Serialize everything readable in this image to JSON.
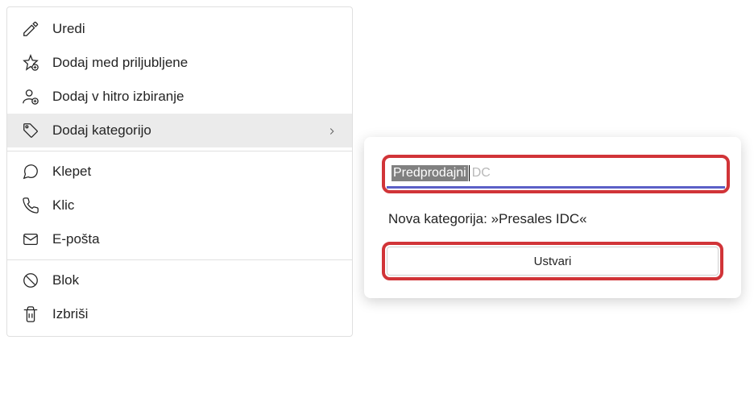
{
  "menu": {
    "edit": "Uredi",
    "addFavorite": "Dodaj med priljubljene",
    "addSpeedDial": "Dodaj v hitro izbiranje",
    "addCategory": "Dodaj kategorijo",
    "chat": "Klepet",
    "call": "Klic",
    "email": "E-pošta",
    "block": "Blok",
    "delete": "Izbriši"
  },
  "popup": {
    "inputHighlighted": "Predprodajni",
    "inputRest": "DC",
    "hint": "Nova kategorija: »Presales IDC«",
    "createLabel": "Ustvari"
  }
}
